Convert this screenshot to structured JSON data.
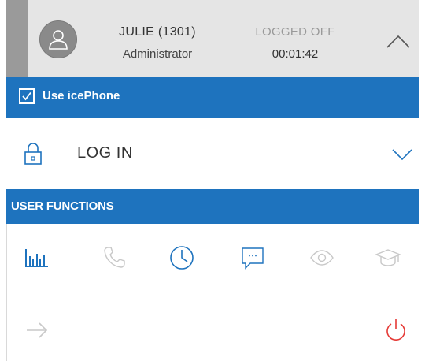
{
  "header": {
    "user_name": "JULIE (1301)",
    "user_role": "Administrator",
    "status": "LOGGED OFF",
    "timer": "00:01:42"
  },
  "icephone": {
    "label": "Use icePhone",
    "checked": true
  },
  "login": {
    "label": "LOG IN"
  },
  "user_functions": {
    "title": "USER FUNCTIONS",
    "icons": [
      {
        "name": "statistics-icon",
        "state": "active"
      },
      {
        "name": "phone-icon",
        "state": "disabled"
      },
      {
        "name": "clock-icon",
        "state": "active"
      },
      {
        "name": "chat-icon",
        "state": "active"
      },
      {
        "name": "eye-icon",
        "state": "disabled"
      },
      {
        "name": "graduation-cap-icon",
        "state": "disabled"
      }
    ]
  },
  "bottom": {
    "icons": [
      {
        "name": "arrow-right-icon",
        "state": "disabled"
      },
      {
        "name": "power-icon",
        "state": "danger"
      }
    ]
  },
  "colors": {
    "accent_blue": "#1e73be",
    "header_gray": "#e5e5e5",
    "disabled_gray": "#c8c8c8",
    "danger_red": "#e53935"
  }
}
